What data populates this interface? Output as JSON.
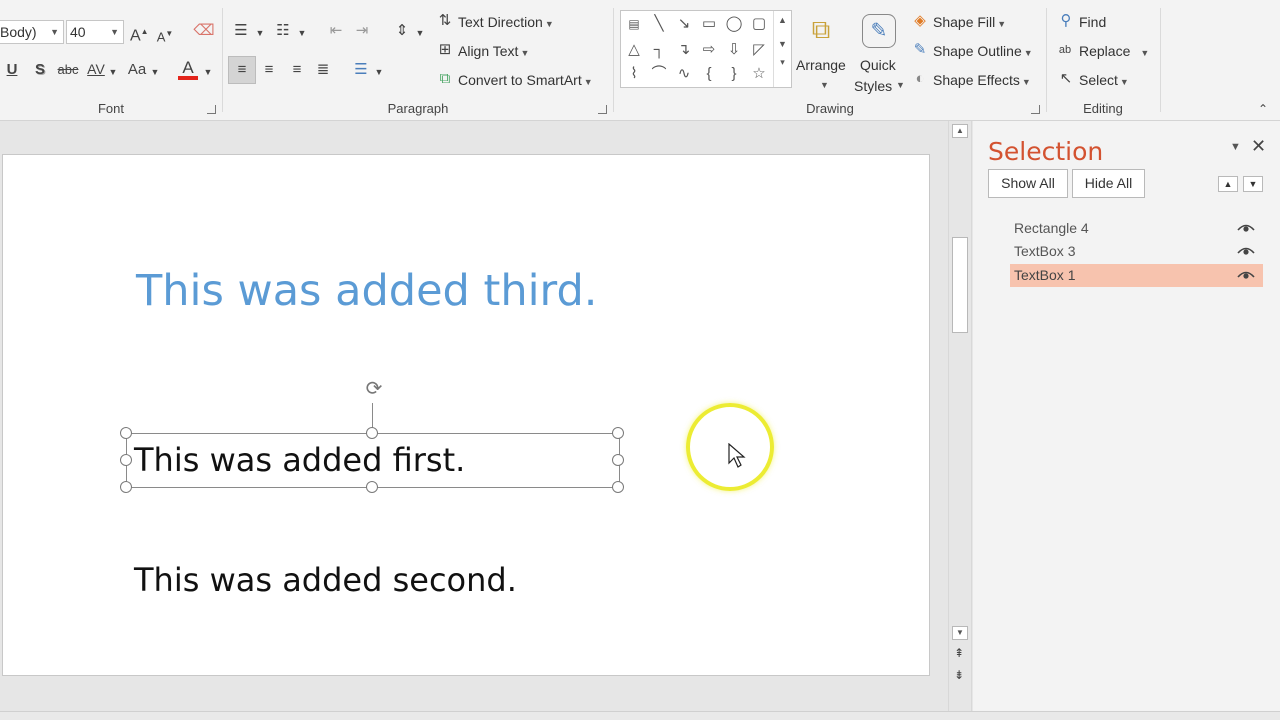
{
  "ribbon": {
    "font": {
      "label": "Font",
      "font_name": "Body)",
      "font_size": "40",
      "grow_label": "A",
      "shrink_label": "A",
      "underline": "U",
      "shadow": "S",
      "strike": "abc",
      "spacing": "AV",
      "case": "Aa",
      "color": "A"
    },
    "paragraph": {
      "label": "Paragraph",
      "text_direction": "Text Direction",
      "align_text": "Align Text",
      "convert_smartart": "Convert to SmartArt"
    },
    "drawing": {
      "label": "Drawing",
      "arrange": "Arrange",
      "quick_styles_1": "Quick",
      "quick_styles_2": "Styles",
      "shape_fill": "Shape Fill",
      "shape_outline": "Shape Outline",
      "shape_effects": "Shape Effects"
    },
    "editing": {
      "label": "Editing",
      "find": "Find",
      "replace": "Replace",
      "select": "Select"
    }
  },
  "slide": {
    "text_third": "This was added third.",
    "text_first": "This was added first.",
    "text_second": "This was added second."
  },
  "selection_pane": {
    "title": "Selection",
    "show_all": "Show All",
    "hide_all": "Hide All",
    "items": [
      {
        "label": "Rectangle 4",
        "selected": false
      },
      {
        "label": "TextBox 3",
        "selected": false
      },
      {
        "label": "TextBox 1",
        "selected": true
      }
    ]
  },
  "colors": {
    "accent_title": "#d35230",
    "selected_item": "#f7c3ae",
    "slide_title_text": "#5b9bd5",
    "cursor_highlight": "#ecec33"
  }
}
